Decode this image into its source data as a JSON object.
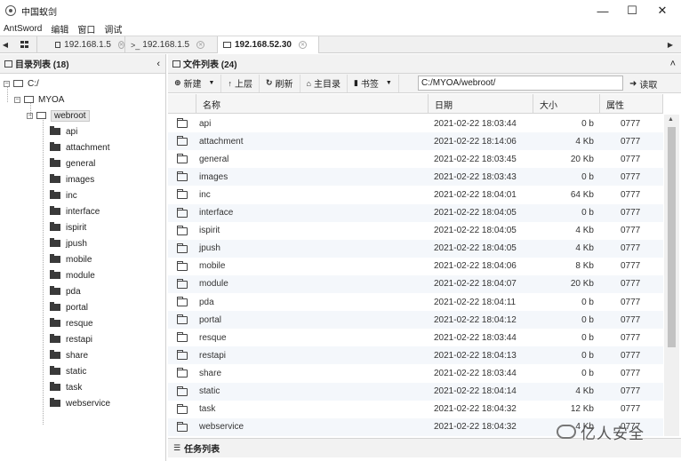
{
  "window": {
    "title": "中国蚁剑",
    "minimize": "—",
    "maximize": "☐",
    "close": "✕"
  },
  "menu": [
    "AntSword",
    "编辑",
    "窗口",
    "调试"
  ],
  "tabs": [
    {
      "label": "192.168.1.5",
      "kind": "folder",
      "active": false
    },
    {
      "label": "192.168.1.5",
      "kind": "terminal",
      "active": false
    },
    {
      "label": "192.168.52.30",
      "kind": "folder",
      "active": true
    }
  ],
  "tab_close": "✕",
  "left_panel": {
    "title": "目录列表 (18)",
    "collapse": "‹",
    "root": "C:/",
    "level1": "MYOA",
    "level2": "webroot",
    "children": [
      "api",
      "attachment",
      "general",
      "images",
      "inc",
      "interface",
      "ispirit",
      "jpush",
      "mobile",
      "module",
      "pda",
      "portal",
      "resque",
      "restapi",
      "share",
      "static",
      "task",
      "webservice"
    ]
  },
  "right_panel": {
    "title": "文件列表 (24)",
    "collapse": "˄",
    "toolbar": {
      "new": "新建",
      "up": "上层",
      "refresh": "刷新",
      "home": "主目录",
      "bookmark": "书签",
      "path": "C:/MYOA/webroot/",
      "read": "读取"
    },
    "columns": {
      "name": "名称",
      "date": "日期",
      "size": "大小",
      "attr": "属性"
    },
    "rows": [
      {
        "name": "api",
        "date": "2021-02-22 18:03:44",
        "size": "0 b",
        "attr": "0777"
      },
      {
        "name": "attachment",
        "date": "2021-02-22 18:14:06",
        "size": "4 Kb",
        "attr": "0777"
      },
      {
        "name": "general",
        "date": "2021-02-22 18:03:45",
        "size": "20 Kb",
        "attr": "0777"
      },
      {
        "name": "images",
        "date": "2021-02-22 18:03:43",
        "size": "0 b",
        "attr": "0777"
      },
      {
        "name": "inc",
        "date": "2021-02-22 18:04:01",
        "size": "64 Kb",
        "attr": "0777"
      },
      {
        "name": "interface",
        "date": "2021-02-22 18:04:05",
        "size": "0 b",
        "attr": "0777"
      },
      {
        "name": "ispirit",
        "date": "2021-02-22 18:04:05",
        "size": "4 Kb",
        "attr": "0777"
      },
      {
        "name": "jpush",
        "date": "2021-02-22 18:04:05",
        "size": "4 Kb",
        "attr": "0777"
      },
      {
        "name": "mobile",
        "date": "2021-02-22 18:04:06",
        "size": "8 Kb",
        "attr": "0777"
      },
      {
        "name": "module",
        "date": "2021-02-22 18:04:07",
        "size": "20 Kb",
        "attr": "0777"
      },
      {
        "name": "pda",
        "date": "2021-02-22 18:04:11",
        "size": "0 b",
        "attr": "0777"
      },
      {
        "name": "portal",
        "date": "2021-02-22 18:04:12",
        "size": "0 b",
        "attr": "0777"
      },
      {
        "name": "resque",
        "date": "2021-02-22 18:03:44",
        "size": "0 b",
        "attr": "0777"
      },
      {
        "name": "restapi",
        "date": "2021-02-22 18:04:13",
        "size": "0 b",
        "attr": "0777"
      },
      {
        "name": "share",
        "date": "2021-02-22 18:03:44",
        "size": "0 b",
        "attr": "0777"
      },
      {
        "name": "static",
        "date": "2021-02-22 18:04:14",
        "size": "4 Kb",
        "attr": "0777"
      },
      {
        "name": "task",
        "date": "2021-02-22 18:04:32",
        "size": "12 Kb",
        "attr": "0777"
      },
      {
        "name": "webservice",
        "date": "2021-02-22 18:04:32",
        "size": "4 Kb",
        "attr": "0777"
      }
    ]
  },
  "task_panel": {
    "title": "任务列表"
  },
  "watermark": "亿人安全"
}
